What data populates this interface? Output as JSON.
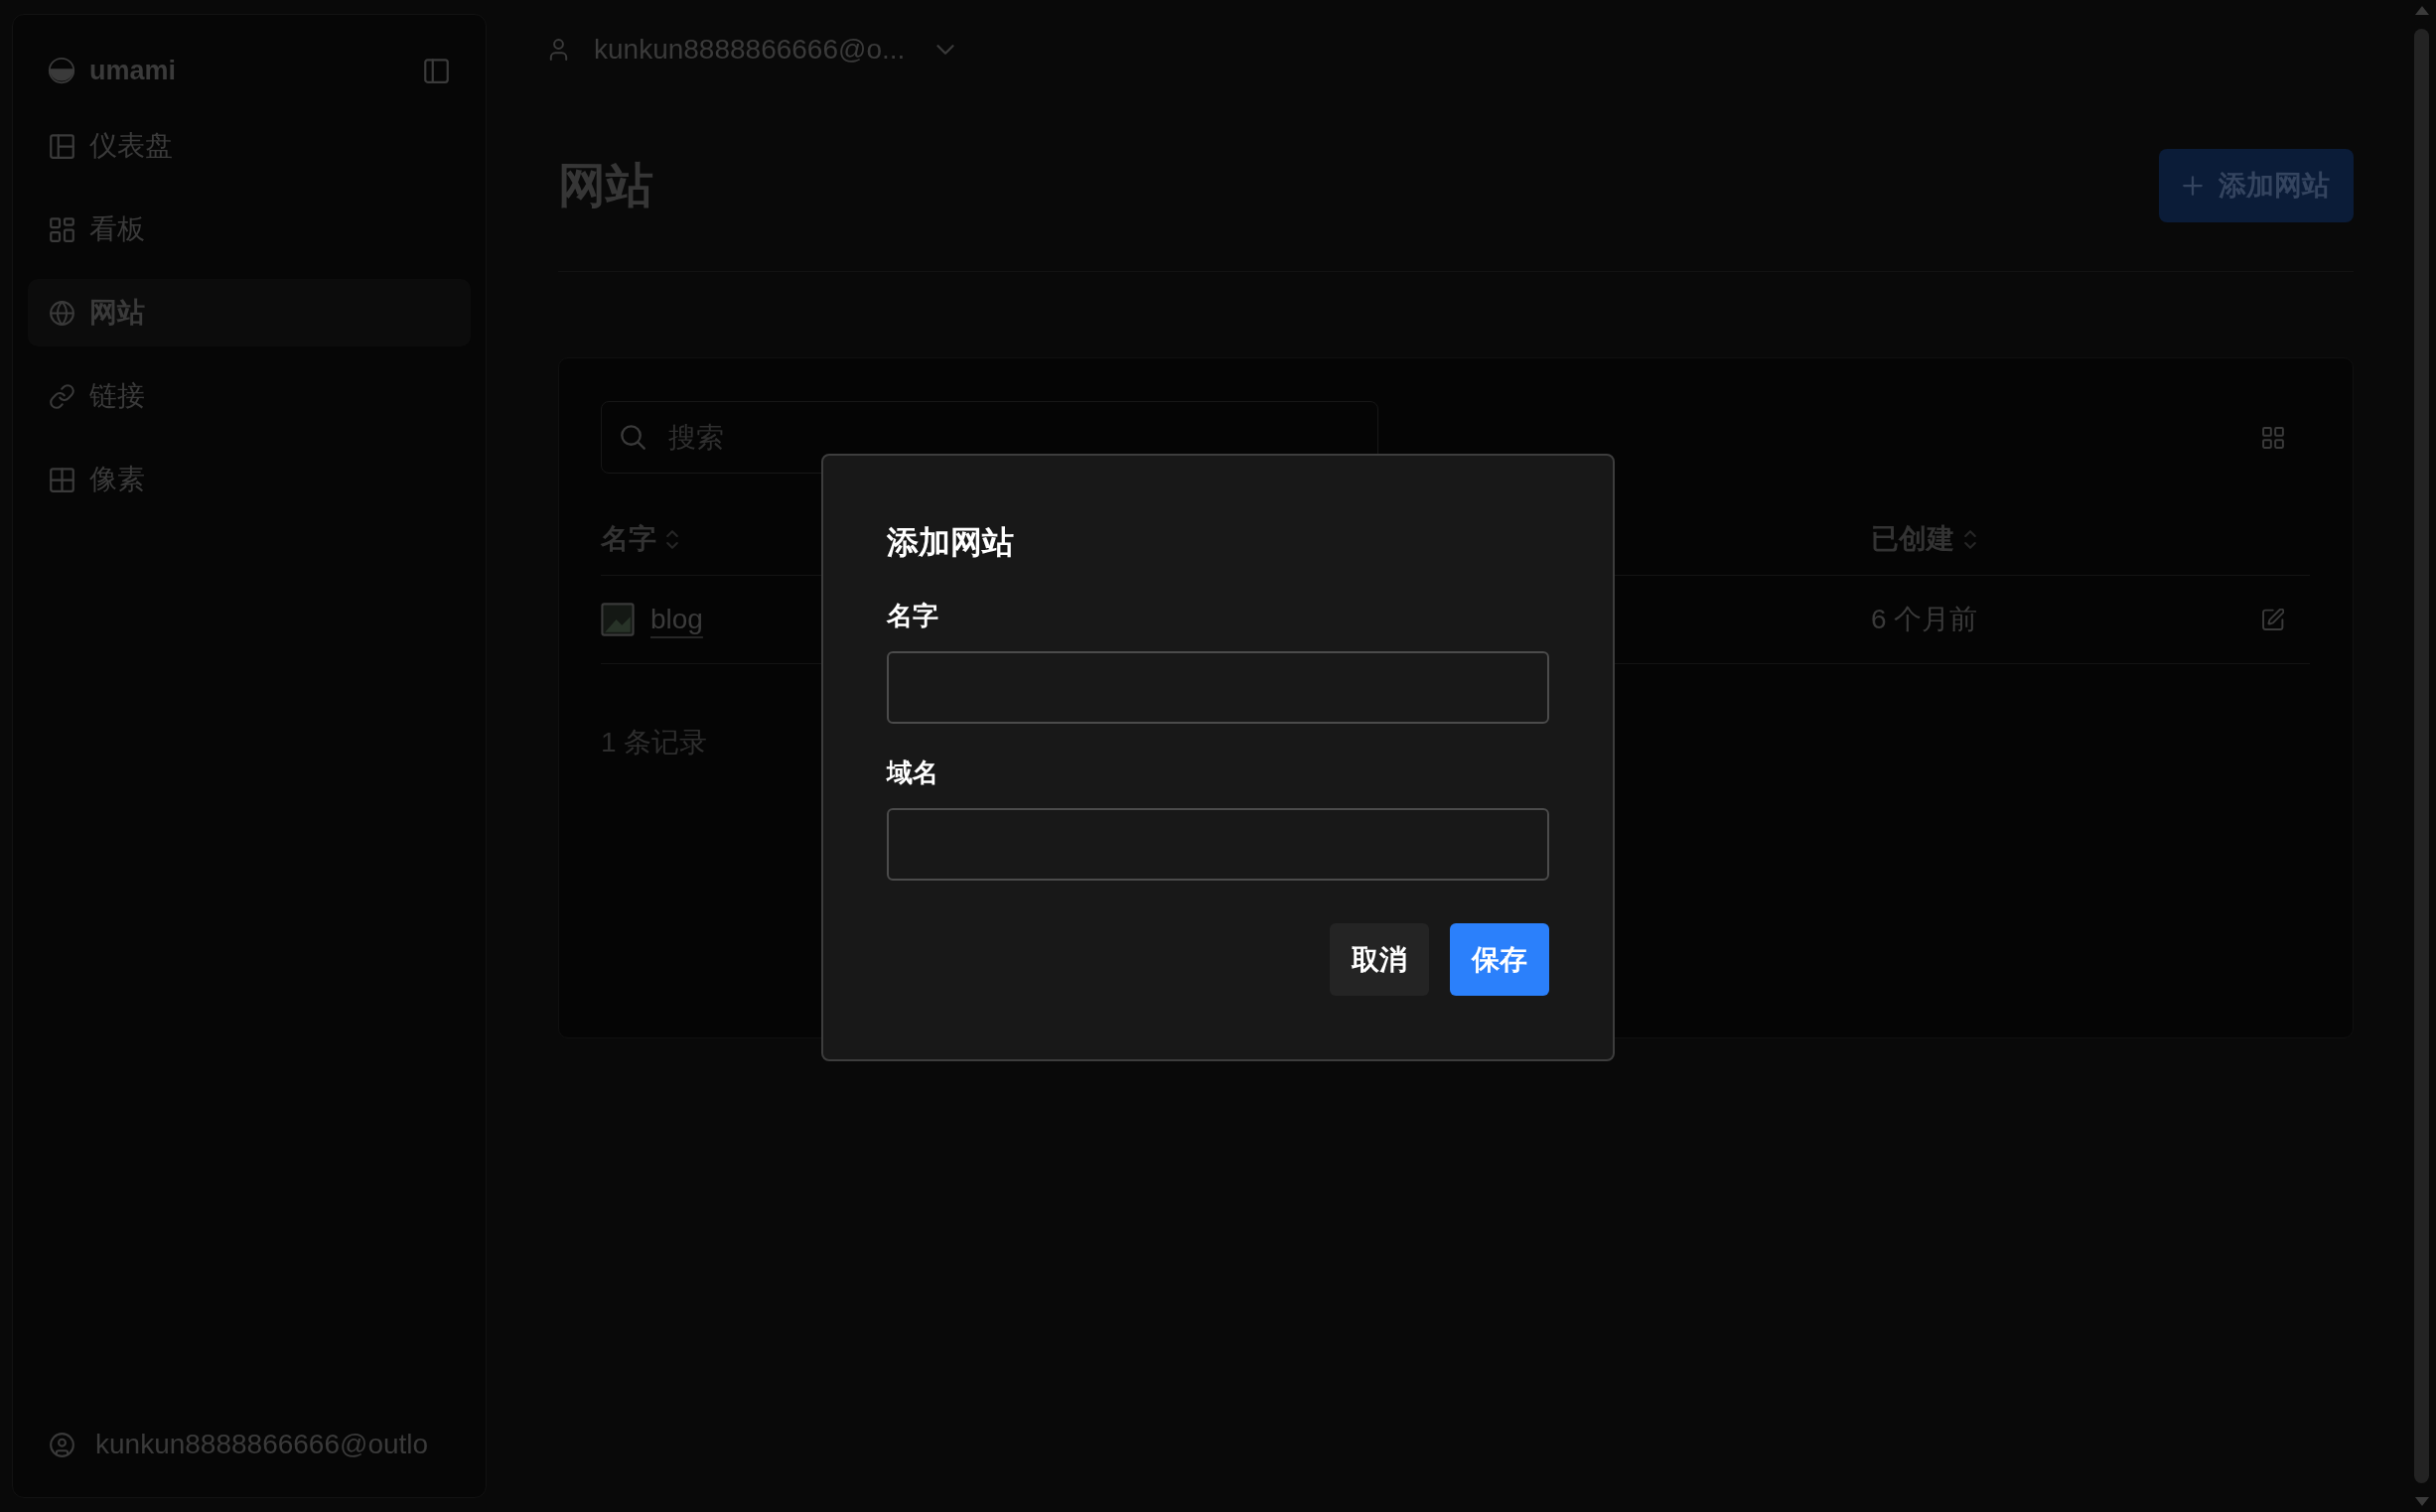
{
  "sidebar": {
    "brand": "umami",
    "items": [
      {
        "label": "仪表盘",
        "selected": false
      },
      {
        "label": "看板",
        "selected": false
      },
      {
        "label": "网站",
        "selected": true
      },
      {
        "label": "链接",
        "selected": false
      },
      {
        "label": "像素",
        "selected": false
      }
    ],
    "user": "kunkun8888866666@outlo"
  },
  "top_bar": {
    "account": "kunkun8888866666@o..."
  },
  "header": {
    "title": "网站",
    "add_button": "添加网站"
  },
  "websites": {
    "search": {
      "placeholder": "搜索"
    },
    "columns": [
      "名字",
      "已创建"
    ],
    "rows": [
      {
        "name": "blog",
        "created": "6 个月前"
      }
    ],
    "count": "1 条记录"
  },
  "dialog": {
    "title": "添加网站",
    "fields": [
      {
        "label": "名字"
      },
      {
        "label": "域名"
      }
    ],
    "buttons": [
      {
        "label": "取消",
        "kind": "secondary"
      },
      {
        "label": "保存",
        "kind": "primary"
      }
    ]
  }
}
